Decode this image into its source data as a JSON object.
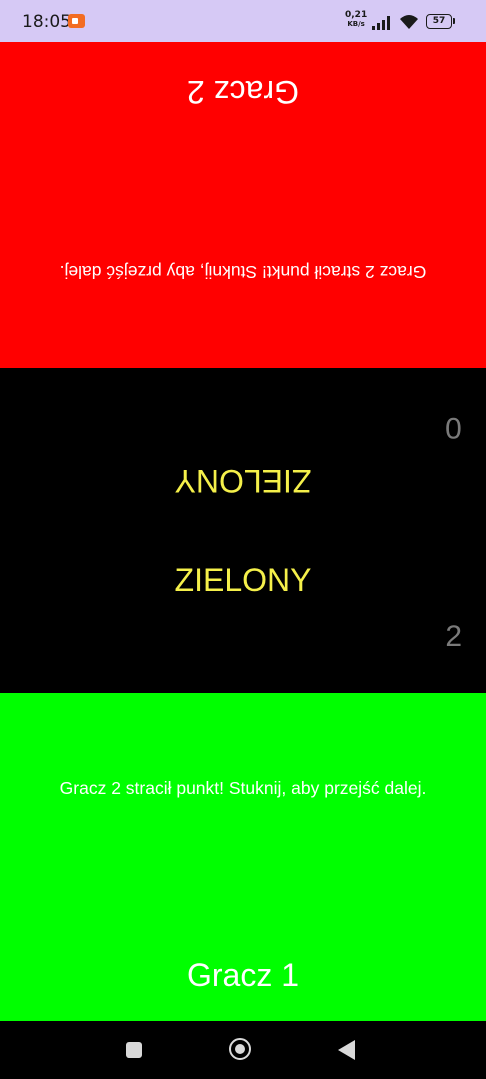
{
  "status_bar": {
    "time": "18:05",
    "net_speed_value": "0,21",
    "net_speed_unit": "KB/s",
    "battery_level": "57",
    "icons": [
      "app-notification-icon",
      "signal-icon",
      "wifi-icon",
      "battery-icon"
    ]
  },
  "player2": {
    "name": "Gracz 2",
    "message": "Gracz 2 stracił punkt! Stuknij, aby przejść dalej.",
    "panel_color": "#ff0000",
    "score": "0"
  },
  "center": {
    "color_word_top": "ZIELONY",
    "color_word_bottom": "ZIELONY",
    "word_color": "#f5f04a"
  },
  "player1": {
    "name": "Gracz 1",
    "message": "Gracz 2 stracił punkt! Stuknij, aby przejść dalej.",
    "panel_color": "#00ff00",
    "score": "2"
  },
  "nav_bar": {
    "buttons": [
      "recents-icon",
      "home-icon",
      "back-icon"
    ]
  }
}
